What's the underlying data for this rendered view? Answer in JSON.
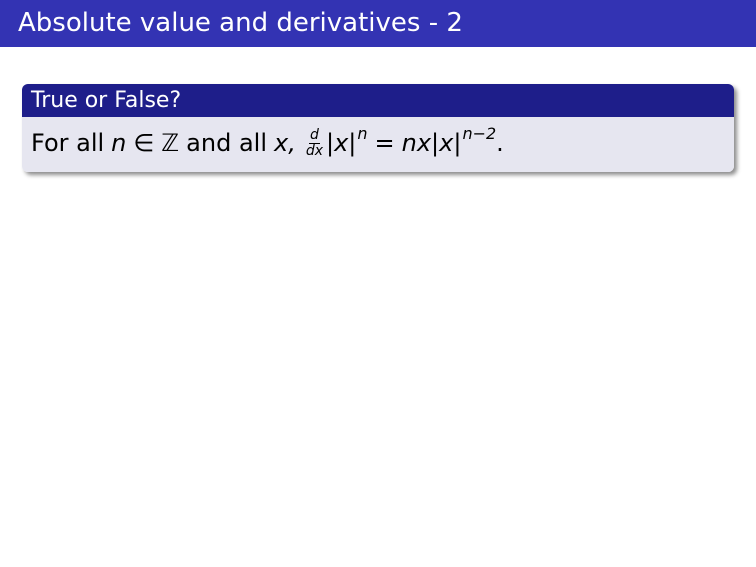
{
  "slide": {
    "title": "Absolute value and derivatives - 2"
  },
  "block": {
    "title": "True or False?",
    "statement": {
      "t1": "For all",
      "n": "n",
      "in": "∈",
      "Z": "ℤ",
      "t2": "and all",
      "x": "x,",
      "frac_num": "d",
      "frac_den": "dx",
      "lhs": "|x|",
      "lhs_exp": "n",
      "eq": "=",
      "rhs": "nx|x|",
      "rhs_exp": "n−2",
      "end": "."
    }
  },
  "colors": {
    "title_bar": "#3333b3",
    "block_header": "#1e1e8a",
    "block_body": "#e6e6f0"
  }
}
